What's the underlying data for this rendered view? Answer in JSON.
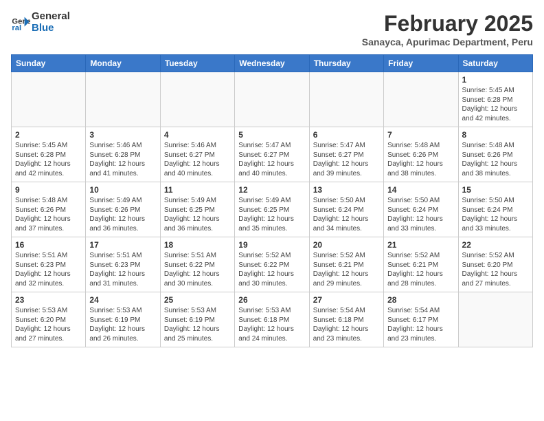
{
  "header": {
    "logo_line1": "General",
    "logo_line2": "Blue",
    "month_year": "February 2025",
    "location": "Sanayca, Apurimac Department, Peru"
  },
  "days_of_week": [
    "Sunday",
    "Monday",
    "Tuesday",
    "Wednesday",
    "Thursday",
    "Friday",
    "Saturday"
  ],
  "weeks": [
    [
      {
        "day": "",
        "info": ""
      },
      {
        "day": "",
        "info": ""
      },
      {
        "day": "",
        "info": ""
      },
      {
        "day": "",
        "info": ""
      },
      {
        "day": "",
        "info": ""
      },
      {
        "day": "",
        "info": ""
      },
      {
        "day": "1",
        "info": "Sunrise: 5:45 AM\nSunset: 6:28 PM\nDaylight: 12 hours and 42 minutes."
      }
    ],
    [
      {
        "day": "2",
        "info": "Sunrise: 5:45 AM\nSunset: 6:28 PM\nDaylight: 12 hours and 42 minutes."
      },
      {
        "day": "3",
        "info": "Sunrise: 5:46 AM\nSunset: 6:28 PM\nDaylight: 12 hours and 41 minutes."
      },
      {
        "day": "4",
        "info": "Sunrise: 5:46 AM\nSunset: 6:27 PM\nDaylight: 12 hours and 40 minutes."
      },
      {
        "day": "5",
        "info": "Sunrise: 5:47 AM\nSunset: 6:27 PM\nDaylight: 12 hours and 40 minutes."
      },
      {
        "day": "6",
        "info": "Sunrise: 5:47 AM\nSunset: 6:27 PM\nDaylight: 12 hours and 39 minutes."
      },
      {
        "day": "7",
        "info": "Sunrise: 5:48 AM\nSunset: 6:26 PM\nDaylight: 12 hours and 38 minutes."
      },
      {
        "day": "8",
        "info": "Sunrise: 5:48 AM\nSunset: 6:26 PM\nDaylight: 12 hours and 38 minutes."
      }
    ],
    [
      {
        "day": "9",
        "info": "Sunrise: 5:48 AM\nSunset: 6:26 PM\nDaylight: 12 hours and 37 minutes."
      },
      {
        "day": "10",
        "info": "Sunrise: 5:49 AM\nSunset: 6:26 PM\nDaylight: 12 hours and 36 minutes."
      },
      {
        "day": "11",
        "info": "Sunrise: 5:49 AM\nSunset: 6:25 PM\nDaylight: 12 hours and 36 minutes."
      },
      {
        "day": "12",
        "info": "Sunrise: 5:49 AM\nSunset: 6:25 PM\nDaylight: 12 hours and 35 minutes."
      },
      {
        "day": "13",
        "info": "Sunrise: 5:50 AM\nSunset: 6:24 PM\nDaylight: 12 hours and 34 minutes."
      },
      {
        "day": "14",
        "info": "Sunrise: 5:50 AM\nSunset: 6:24 PM\nDaylight: 12 hours and 33 minutes."
      },
      {
        "day": "15",
        "info": "Sunrise: 5:50 AM\nSunset: 6:24 PM\nDaylight: 12 hours and 33 minutes."
      }
    ],
    [
      {
        "day": "16",
        "info": "Sunrise: 5:51 AM\nSunset: 6:23 PM\nDaylight: 12 hours and 32 minutes."
      },
      {
        "day": "17",
        "info": "Sunrise: 5:51 AM\nSunset: 6:23 PM\nDaylight: 12 hours and 31 minutes."
      },
      {
        "day": "18",
        "info": "Sunrise: 5:51 AM\nSunset: 6:22 PM\nDaylight: 12 hours and 30 minutes."
      },
      {
        "day": "19",
        "info": "Sunrise: 5:52 AM\nSunset: 6:22 PM\nDaylight: 12 hours and 30 minutes."
      },
      {
        "day": "20",
        "info": "Sunrise: 5:52 AM\nSunset: 6:21 PM\nDaylight: 12 hours and 29 minutes."
      },
      {
        "day": "21",
        "info": "Sunrise: 5:52 AM\nSunset: 6:21 PM\nDaylight: 12 hours and 28 minutes."
      },
      {
        "day": "22",
        "info": "Sunrise: 5:52 AM\nSunset: 6:20 PM\nDaylight: 12 hours and 27 minutes."
      }
    ],
    [
      {
        "day": "23",
        "info": "Sunrise: 5:53 AM\nSunset: 6:20 PM\nDaylight: 12 hours and 27 minutes."
      },
      {
        "day": "24",
        "info": "Sunrise: 5:53 AM\nSunset: 6:19 PM\nDaylight: 12 hours and 26 minutes."
      },
      {
        "day": "25",
        "info": "Sunrise: 5:53 AM\nSunset: 6:19 PM\nDaylight: 12 hours and 25 minutes."
      },
      {
        "day": "26",
        "info": "Sunrise: 5:53 AM\nSunset: 6:18 PM\nDaylight: 12 hours and 24 minutes."
      },
      {
        "day": "27",
        "info": "Sunrise: 5:54 AM\nSunset: 6:18 PM\nDaylight: 12 hours and 23 minutes."
      },
      {
        "day": "28",
        "info": "Sunrise: 5:54 AM\nSunset: 6:17 PM\nDaylight: 12 hours and 23 minutes."
      },
      {
        "day": "",
        "info": ""
      }
    ]
  ]
}
